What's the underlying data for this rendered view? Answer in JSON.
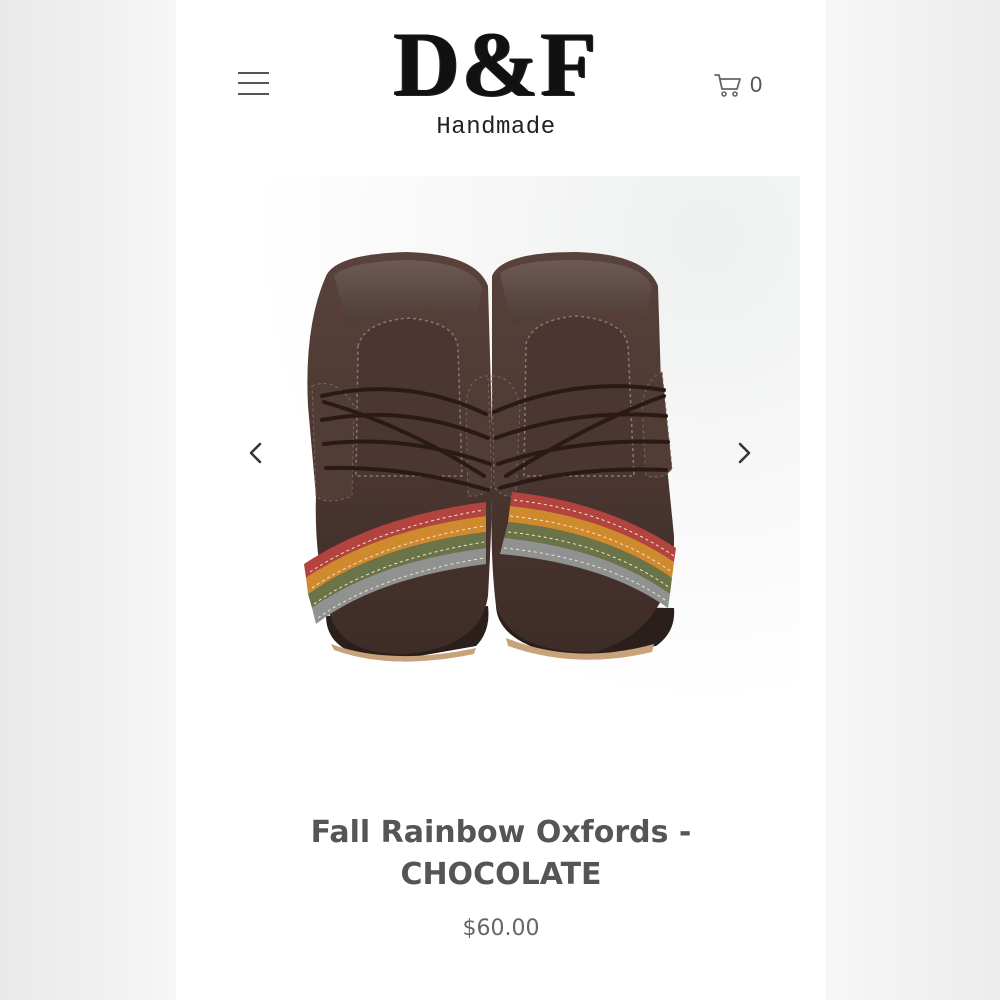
{
  "header": {
    "menu_icon": "hamburger-menu-icon",
    "logo": {
      "mark": "D&F",
      "subtitle": "Handmade"
    },
    "cart": {
      "icon": "shopping-cart-icon",
      "count": "0"
    }
  },
  "product": {
    "image_alt": "Fall Rainbow Oxfords - CHOCOLATE",
    "title_line1": "Fall Rainbow Oxfords -",
    "title_line2": "CHOCOLATE",
    "price": "$60.00"
  },
  "carousel": {
    "prev_icon": "chevron-left-icon",
    "next_icon": "chevron-right-icon"
  },
  "colors": {
    "leather": "#4a3530",
    "stripe_red": "#b3433f",
    "stripe_orange": "#d08a2e",
    "stripe_olive": "#6b7349",
    "stripe_grey": "#8f9291",
    "text": "#555555"
  }
}
